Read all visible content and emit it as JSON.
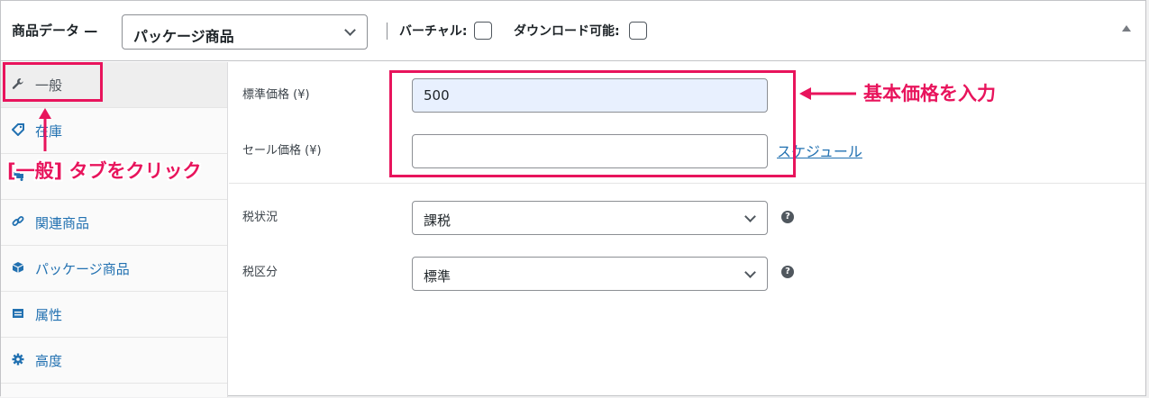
{
  "header": {
    "title": "商品データ —",
    "product_type": "パッケージ商品",
    "virtual_label": "バーチャル:",
    "downloadable_label": "ダウンロード可能:"
  },
  "tabs": [
    {
      "label": "一般",
      "icon": "wrench-icon",
      "active": true
    },
    {
      "label": "在庫",
      "icon": "tag-icon",
      "active": false
    },
    {
      "label": "",
      "icon": "truck-icon",
      "active": false
    },
    {
      "label": "関連商品",
      "icon": "link-icon",
      "active": false
    },
    {
      "label": "パッケージ商品",
      "icon": "cube-icon",
      "active": false
    },
    {
      "label": "属性",
      "icon": "list-icon",
      "active": false
    },
    {
      "label": "高度",
      "icon": "gear-icon",
      "active": false
    }
  ],
  "form": {
    "regular_price_label": "標準価格 (¥)",
    "regular_price_value": "500",
    "sale_price_label": "セール価格 (¥)",
    "sale_price_value": "",
    "schedule_link": "スケジュール",
    "tax_status_label": "税状況",
    "tax_status_value": "課税",
    "tax_class_label": "税区分",
    "tax_class_value": "標準",
    "help_glyph": "?"
  },
  "annotations": {
    "tab_instruction": "[一般] タブをクリック",
    "price_instruction": "基本価格を入力",
    "color": "#e8145c"
  },
  "colors": {
    "accent": "#2271b1",
    "border": "#c3c4c7",
    "filled_input": "#e8f0fe"
  }
}
